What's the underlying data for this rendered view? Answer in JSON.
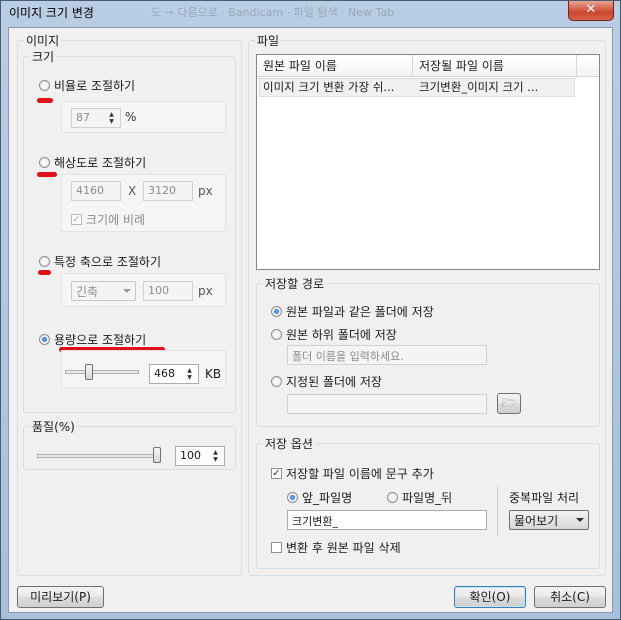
{
  "window": {
    "title": "이미지 크기 변경",
    "close_symbol": "✕",
    "background_tabs": "도 → 다음으로 · Bandicam · 파일 탐색 · New Tab"
  },
  "image": {
    "legend": "이미지",
    "size": {
      "legend": "크기",
      "ratio": {
        "label": "비율로 조절하기",
        "value": "87",
        "unit": "%"
      },
      "resolution": {
        "label": "해상도로 조절하기",
        "width": "4160",
        "x_sep": "X",
        "height": "3120",
        "unit": "px",
        "keep_ratio": "크기에 비례"
      },
      "axis": {
        "label": "특정 축으로 조절하기",
        "axis_value": "긴축",
        "value": "100",
        "unit": "px"
      },
      "capacity": {
        "label": "용량으로 조절하기",
        "value": "468",
        "unit": "KB",
        "slider_level": 0.3
      }
    },
    "quality": {
      "legend": "품질(%)",
      "value": "100",
      "slider_level": 1.0
    }
  },
  "files": {
    "legend": "파일",
    "columns": [
      "원본 파일 이름",
      "저장될 파일 이름"
    ],
    "rows": [
      {
        "original": "이미지 크기 변환 가장 쉬...",
        "saved": "크기변환_이미지 크기 ..."
      }
    ]
  },
  "save_path": {
    "legend": "저장할 경로",
    "options": [
      "원본 파일과 같은 폴더에 저장",
      "원본 하위 폴더에 저장",
      "지정된 폴더에 저장"
    ],
    "subfolder_placeholder": "폴더 이름을 입력하세요.",
    "folder_value": ""
  },
  "save_options": {
    "legend": "저장 옵션",
    "add_text_label": "저장할 파일 이름에 문구 추가",
    "front_label": "앞_파일명",
    "back_label": "파일명_뒤",
    "text_value": "크기변환_",
    "dup_label": "중복파일 처리",
    "dup_value": "물어보기",
    "delete_label": "변환 후 원본 파일 삭제"
  },
  "buttons": {
    "preview": "미리보기(P)",
    "ok": "확인(O)",
    "cancel": "취소(C)"
  },
  "colors": {
    "annotation_red": "#e0101a",
    "title_close": "#c9452d"
  }
}
